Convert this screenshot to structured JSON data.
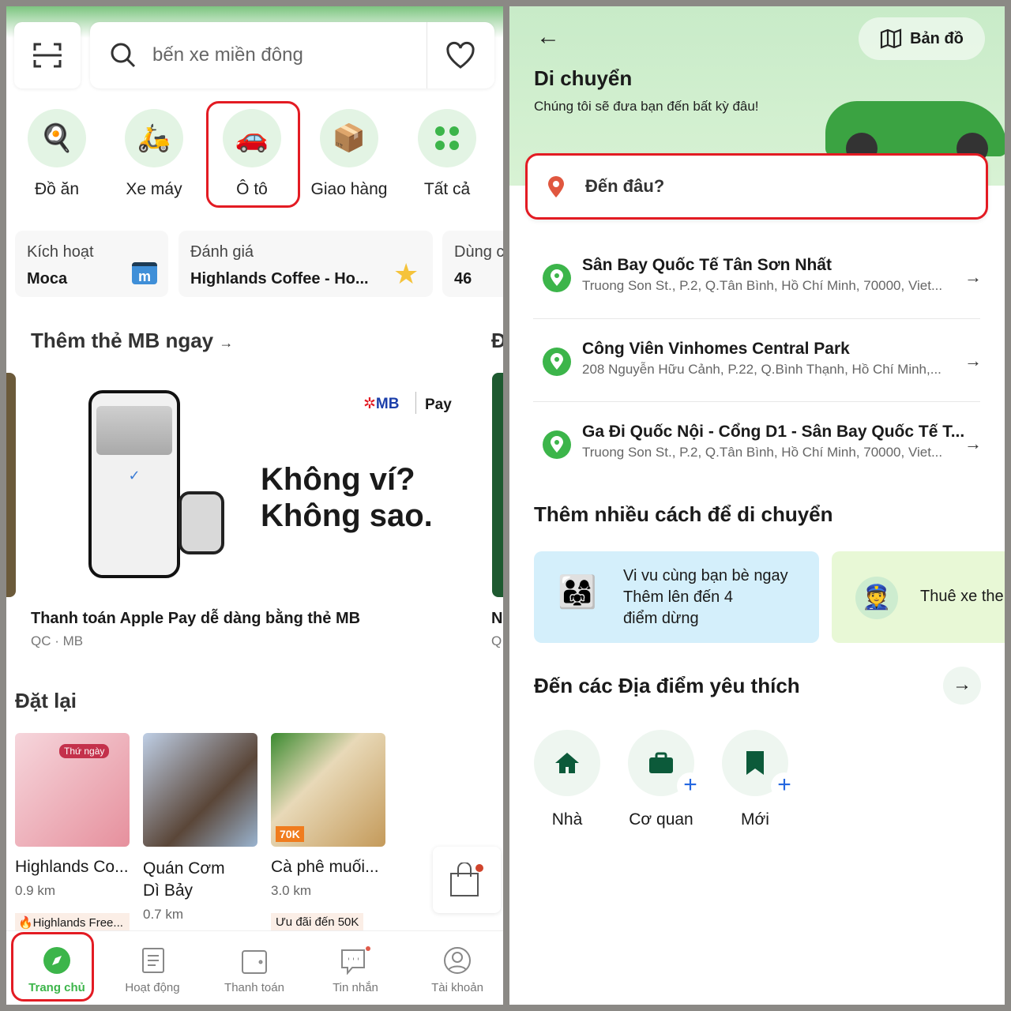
{
  "home": {
    "search": {
      "placeholder": "bến xe miền đông",
      "icons": [
        "scan-icon",
        "search-icon",
        "heart-icon"
      ]
    },
    "categories": [
      {
        "label": "Đồ ăn",
        "icon": "food-icon"
      },
      {
        "label": "Xe máy",
        "icon": "motorbike-icon"
      },
      {
        "label": "Ô tô",
        "icon": "car-icon",
        "highlighted": true
      },
      {
        "label": "Giao hàng",
        "icon": "delivery-icon"
      },
      {
        "label": "Tất cả",
        "icon": "grid-icon"
      }
    ],
    "quick_cards": [
      {
        "label": "Kích hoạt",
        "value": "Moca",
        "icon": "moca-icon"
      },
      {
        "label": "Đánh giá",
        "value": "Highlands Coffee - Ho...",
        "icon": "star-icon"
      },
      {
        "label": "Dùng c",
        "value": "46"
      }
    ],
    "promo": {
      "title": "Thêm thẻ MB ngay",
      "banner_brand": "MB",
      "banner_pay": "Pay",
      "banner_headline_1": "Không ví?",
      "banner_headline_2": "Không sao.",
      "caption": "Thanh toán Apple Pay dễ dàng bằng thẻ MB",
      "sponsor": "QC · MB",
      "next_title_peek": "Đ",
      "next_caption_peek": "N",
      "next_sponsor_peek": "Q"
    },
    "reorder": {
      "title": "Đặt lại",
      "items": [
        {
          "name": "Highlands Co...",
          "distance": "0.9 km",
          "tag": "🔥Highlands Free...",
          "image_badge": "Thứ ngày"
        },
        {
          "name": "Quán Cơm Dì Bảy",
          "distance": "0.7 km"
        },
        {
          "name": "Cà phê muối...",
          "distance": "3.0 km",
          "tag": "Ưu đãi đến 50K",
          "image_badge": "70K"
        }
      ]
    },
    "bottom_nav": [
      {
        "label": "Trang chủ",
        "icon": "compass-icon",
        "active": true
      },
      {
        "label": "Hoạt động",
        "icon": "activity-icon"
      },
      {
        "label": "Thanh toán",
        "icon": "wallet-icon"
      },
      {
        "label": "Tin nhắn",
        "icon": "chat-icon",
        "badge": true
      },
      {
        "label": "Tài khoản",
        "icon": "account-icon"
      }
    ]
  },
  "transport": {
    "map_button": "Bản đồ",
    "title": "Di chuyển",
    "subtitle": "Chúng tôi sẽ đưa bạn đến bất kỳ đâu!",
    "destination_placeholder": "Đến đâu?",
    "recent": [
      {
        "title": "Sân Bay Quốc Tế Tân Sơn Nhất",
        "address": "Truong Son St., P.2, Q.Tân Bình, Hồ Chí Minh, 70000, Viet..."
      },
      {
        "title": "Công Viên Vinhomes Central Park",
        "address": "208 Nguyễn Hữu Cảnh, P.22, Q.Bình Thạnh, Hồ Chí Minh,..."
      },
      {
        "title": "Ga Đi Quốc Nội - Cổng D1 - Sân Bay Quốc Tế T...",
        "address": "Truong Son St., P.2, Q.Tân Bình, Hồ Chí Minh, 70000, Viet..."
      }
    ],
    "more_ways_title": "Thêm nhiều cách để di chuyển",
    "more_ways": [
      {
        "line1": "Vi vu cùng bạn bè ngay",
        "line2": "Thêm lên đến 4",
        "line3": "điểm dừng"
      },
      {
        "line1": "Thuê xe the"
      }
    ],
    "favorites_title": "Đến các Địa điểm yêu thích",
    "favorites": [
      {
        "label": "Nhà",
        "icon": "home-icon"
      },
      {
        "label": "Cơ quan",
        "icon": "briefcase-icon"
      },
      {
        "label": "Mới",
        "icon": "bookmark-icon"
      }
    ]
  },
  "colors": {
    "brand_green": "#00b14f",
    "highlight_red": "#e31b23",
    "header_green": "#cdeccd"
  }
}
